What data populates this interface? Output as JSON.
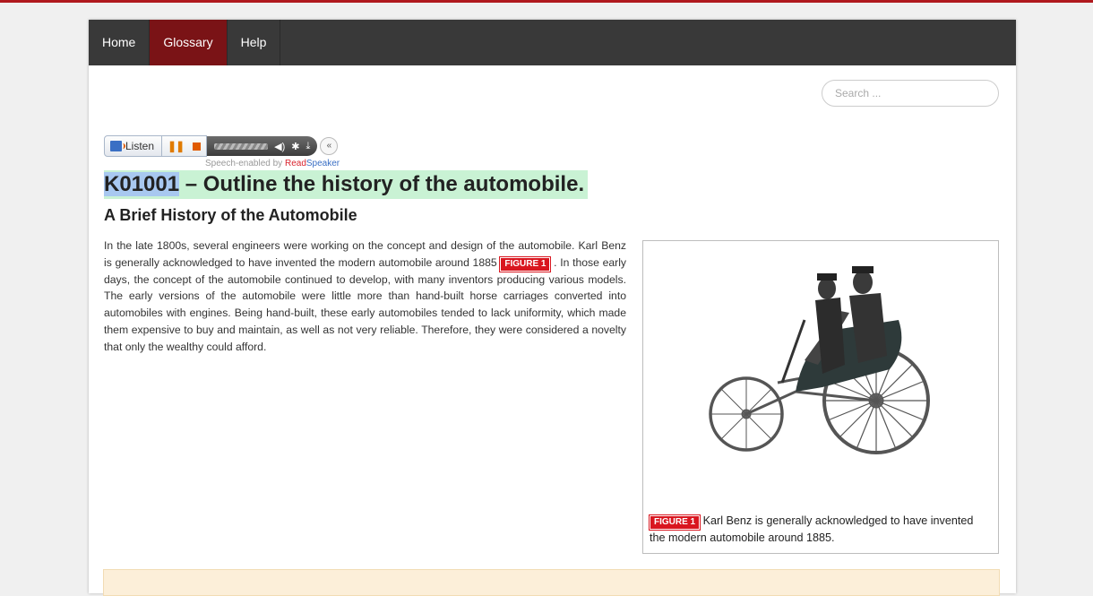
{
  "nav": {
    "items": [
      {
        "label": "Home",
        "active": false
      },
      {
        "label": "Glossary",
        "active": true
      },
      {
        "label": "Help",
        "active": false
      }
    ]
  },
  "search": {
    "placeholder": "Search ..."
  },
  "readspeaker": {
    "listen_label": "Listen",
    "credit_prefix": "Speech-enabled by ",
    "credit_brand_red": "Read",
    "credit_brand_blue": "Speaker",
    "collapse_symbol": "«"
  },
  "heading": {
    "code": "K01001",
    "title_rest": " – Outline the history of the automobile."
  },
  "subheading": "A Brief History of the Automobile",
  "body": {
    "part1": "In the late 1800s, several engineers were working on the concept and design of the automobile. Karl Benz is generally acknowledged to have invented the modern automobile around 1885 ",
    "figure_ref": "FIGURE 1",
    "part2": " . In those early days, the concept of the automobile continued to develop, with many inventors producing various models. The early versions of the automobile were little more than hand-built horse carriages converted into automobiles with engines. Being hand-built, these early automobiles tended to lack uniformity, which made them expensive to buy and maintain, as well as not very reliable. Therefore, they were considered a novelty that only the wealthy could afford."
  },
  "figure": {
    "tag": "FIGURE 1",
    "caption": " Karl Benz is generally acknowledged to have invented the modern automobile around 1885."
  },
  "colors": {
    "nav_bg": "#393939",
    "nav_active": "#7a1316",
    "accent_red": "#d9161f",
    "title_highlight": "#c9f2d4",
    "code_highlight": "#a8c8f0"
  }
}
